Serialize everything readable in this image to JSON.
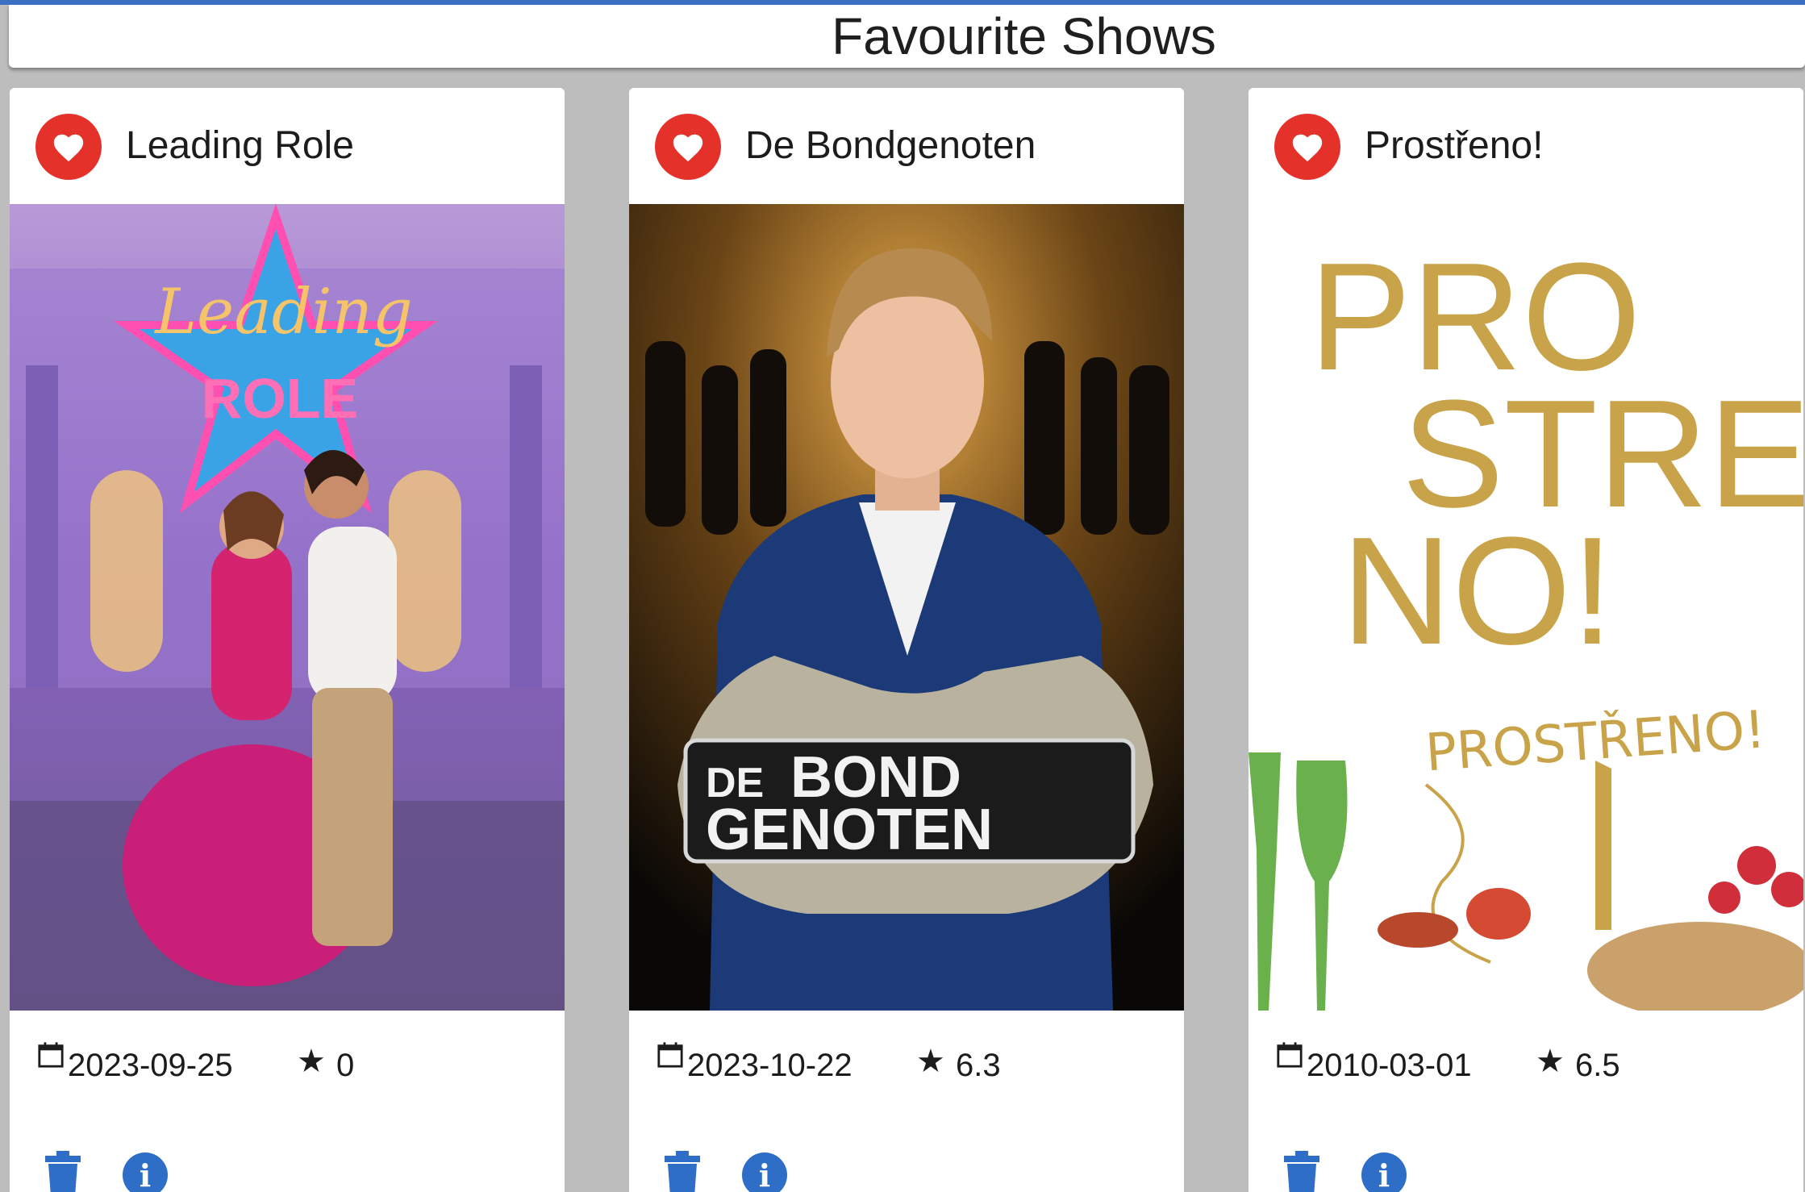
{
  "header": {
    "title": "Favourite Shows"
  },
  "colors": {
    "accent": "#3b6fc4",
    "favourite": "#e4322b",
    "action": "#2f6ec7"
  },
  "icons": {
    "favourite": "heart-icon",
    "date": "calendar-icon",
    "rating": "star-icon",
    "delete": "trash-icon",
    "info": "info-icon"
  },
  "shows": [
    {
      "title": "Leading Role",
      "date": "2023-09-25",
      "star": "★",
      "rating": "0",
      "poster_text": [
        "Leading",
        "ROLE"
      ]
    },
    {
      "title": "De Bondgenoten",
      "date": "2023-10-22",
      "star": "★",
      "rating": "6.3",
      "poster_text": [
        "DE",
        "BOND",
        "GENOTEN"
      ]
    },
    {
      "title": "Prostřeno!",
      "date": "2010-03-01",
      "star": "★",
      "rating": "6.5",
      "poster_text": [
        "PRO",
        "STRE",
        "NO!",
        "PROSTŘENO!"
      ]
    }
  ]
}
